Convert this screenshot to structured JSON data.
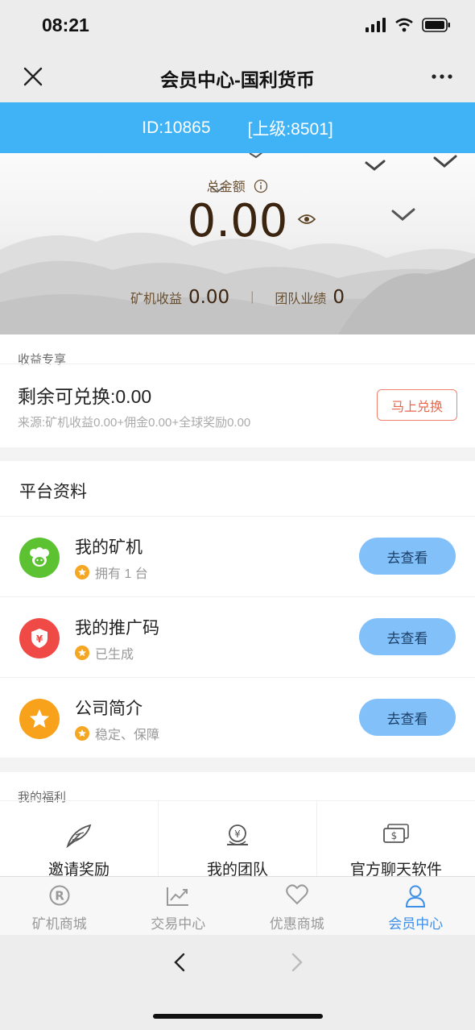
{
  "status_bar": {
    "time": "08:21"
  },
  "nav": {
    "title": "会员中心-国利货币"
  },
  "id_bar": {
    "id_text": "ID:10865",
    "parent_text": "[上级:8501]"
  },
  "summary": {
    "total_label": "总金额",
    "total_value": "0.00",
    "mining_label": "矿机收益",
    "mining_value": "0.00",
    "team_label": "团队业绩",
    "team_value": "0"
  },
  "earnings": {
    "title": "收益专享",
    "remaining": "剩余可兑换:0.00",
    "source": "来源:矿机收益0.00+佣金0.00+全球奖励0.00",
    "button": "马上兑换"
  },
  "platform": {
    "title": "平台资料",
    "items": [
      {
        "title": "我的矿机",
        "sub": "拥有 1 台",
        "button": "去查看",
        "icon": "sheep-icon",
        "color": "#5cc232"
      },
      {
        "title": "我的推广码",
        "sub": "已生成",
        "button": "去查看",
        "icon": "yen-shield-icon",
        "color": "#ef4a45"
      },
      {
        "title": "公司简介",
        "sub": "稳定、保障",
        "button": "去查看",
        "icon": "star-icon",
        "color": "#f7a21a"
      }
    ]
  },
  "welfare": {
    "title": "我的福利",
    "items": [
      {
        "label": "邀请奖励",
        "icon": "feather-icon"
      },
      {
        "label": "我的团队",
        "icon": "yen-pot-icon"
      },
      {
        "label": "官方聊天软件",
        "icon": "dollar-bill-icon"
      }
    ]
  },
  "tabbar": {
    "tabs": [
      {
        "label": "矿机商城",
        "icon": "registered-icon"
      },
      {
        "label": "交易中心",
        "icon": "trend-chart-icon"
      },
      {
        "label": "优惠商城",
        "icon": "heart-icon"
      },
      {
        "label": "会员中心",
        "icon": "person-icon",
        "active": true
      }
    ]
  },
  "colors": {
    "id_bar": "#3fb3f6",
    "view_button": "#82c0fa",
    "exchange_border": "#f0836b",
    "active_tab": "#3d8fe8"
  }
}
